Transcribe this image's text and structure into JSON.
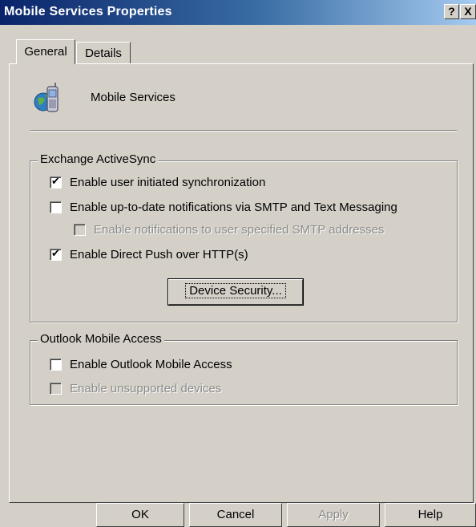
{
  "window": {
    "title": "Mobile Services Properties",
    "help_button": "?",
    "close_button": "X"
  },
  "tabs": [
    {
      "label": "General",
      "active": true
    },
    {
      "label": "Details",
      "active": false
    }
  ],
  "header": {
    "icon": "mobile-phone-globe-icon",
    "name": "Mobile Services"
  },
  "activesync": {
    "legend": "Exchange ActiveSync",
    "items": [
      {
        "label": "Enable user initiated synchronization",
        "checked": true,
        "enabled": true
      },
      {
        "label": "Enable up-to-date notifications via SMTP and Text Messaging",
        "checked": false,
        "enabled": true
      },
      {
        "label": "Enable notifications to user specified SMTP addresses",
        "checked": false,
        "enabled": false
      },
      {
        "label": "Enable Direct Push over HTTP(s)",
        "checked": true,
        "enabled": true
      }
    ],
    "device_security_button": "Device Security..."
  },
  "oma": {
    "legend": "Outlook Mobile Access",
    "items": [
      {
        "label": "Enable Outlook Mobile Access",
        "checked": false,
        "enabled": true
      },
      {
        "label": "Enable unsupported devices",
        "checked": false,
        "enabled": false
      }
    ]
  },
  "buttons": {
    "ok": "OK",
    "cancel": "Cancel",
    "apply": "Apply",
    "help": "Help"
  }
}
